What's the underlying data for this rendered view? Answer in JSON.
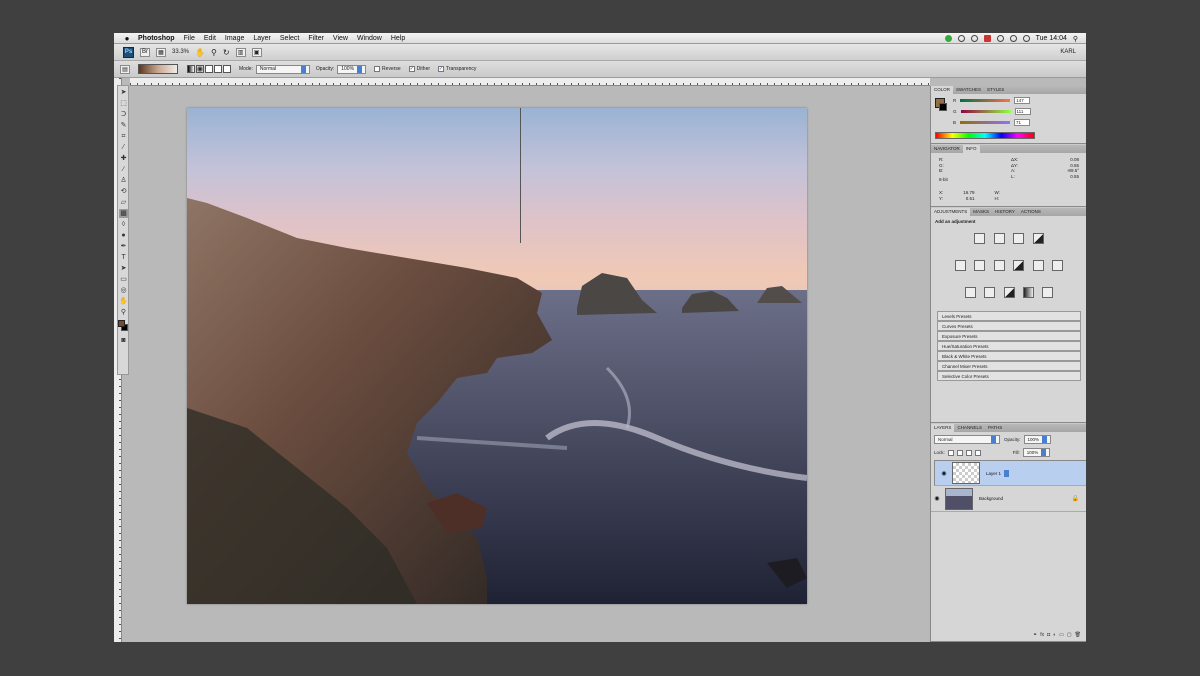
{
  "menubar": {
    "app_name": "Photoshop",
    "items": [
      "File",
      "Edit",
      "Image",
      "Layer",
      "Select",
      "Filter",
      "View",
      "Window",
      "Help"
    ],
    "clock": "Tue 14:04"
  },
  "appbar": {
    "zoom": "33.3%",
    "user": "KARL"
  },
  "options": {
    "mode_label": "Mode:",
    "mode_value": "Normal",
    "opacity_label": "Opacity:",
    "opacity_value": "100%",
    "reverse_label": "Reverse",
    "dither_label": "Dither",
    "transparency_label": "Transparency"
  },
  "color_panel": {
    "tabs": [
      "COLOR",
      "SWATCHES",
      "STYLES"
    ],
    "r_label": "R",
    "r_value": "147",
    "g_label": "G",
    "g_value": "111",
    "b_label": "B",
    "b_value": "71"
  },
  "info_panel": {
    "tabs": [
      "NAVIGATOR",
      "INFO"
    ],
    "line1_left": "R:",
    "line1_right": "ΔX:",
    "line1_value": "0.08",
    "line2_left": "G:",
    "line2_right": "ΔY:",
    "line2_value": "0.55",
    "line3_left": "B:",
    "line3_right": "A:",
    "line3_value": "-89.5°",
    "line4_right": "L:",
    "line4_value": "0.55",
    "bitdepth": "8-bit",
    "x_label": "X:",
    "x_value": "16.79",
    "y_label": "Y:",
    "y_value": "0.51",
    "w_label": "W:",
    "h_label": "H:"
  },
  "adjust_panel": {
    "tabs": [
      "ADJUSTMENTS",
      "MASKS",
      "HISTORY",
      "ACTIONS"
    ],
    "heading": "Add an adjustment",
    "presets": [
      "Levels Presets",
      "Curves Presets",
      "Exposure Presets",
      "Hue/Saturation Presets",
      "Black & White Presets",
      "Channel Mixer Presets",
      "Selective Color Presets"
    ]
  },
  "layers_panel": {
    "tabs": [
      "LAYERS",
      "CHANNELS",
      "PATHS"
    ],
    "blend_mode": "Normal",
    "opacity_label": "Opacity:",
    "opacity_value": "100%",
    "lock_label": "Lock:",
    "fill_label": "Fill:",
    "fill_value": "100%",
    "layers": [
      "Layer 1",
      "Background"
    ]
  }
}
